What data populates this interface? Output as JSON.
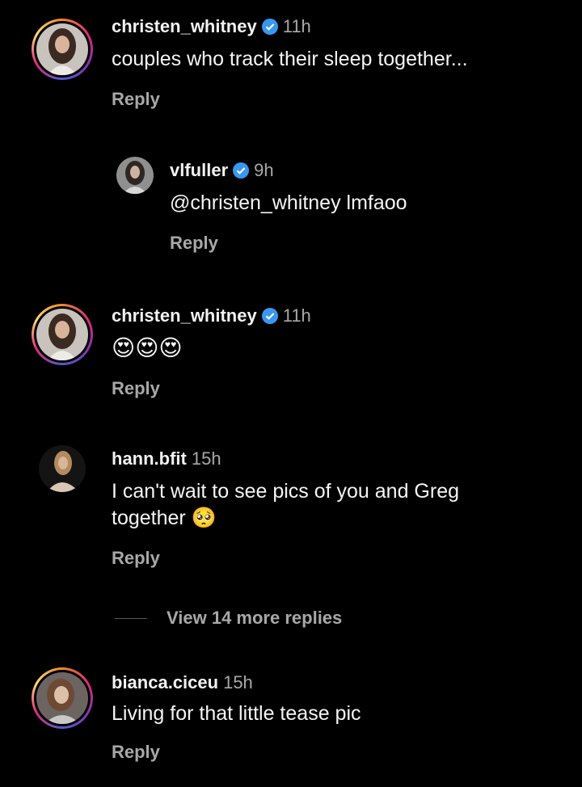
{
  "comments": [
    {
      "username": "christen_whitney",
      "verified": true,
      "time": "11h",
      "text": "couples who track their sleep together...",
      "reply_label": "Reply"
    },
    {
      "username": "vlfuller",
      "verified": true,
      "time": "9h",
      "text": "@christen_whitney lmfaoo",
      "reply_label": "Reply"
    },
    {
      "username": "christen_whitney",
      "verified": true,
      "time": "11h",
      "text": "😍😍😍",
      "reply_label": "Reply"
    },
    {
      "username": "hann.bfit",
      "verified": false,
      "time": "15h",
      "text_line1": "I can't wait to see pics of you and Greg",
      "text_line2": "together 🥺",
      "reply_label": "Reply"
    },
    {
      "username": "bianca.ciceu",
      "verified": false,
      "time": "15h",
      "text": "Living for that little tease pic",
      "reply_label": "Reply"
    }
  ],
  "view_more_replies": "View 14 more replies",
  "colors": {
    "background": "#000000",
    "verified_badge": "#3897f0",
    "secondary_text": "#a8a8a8"
  }
}
